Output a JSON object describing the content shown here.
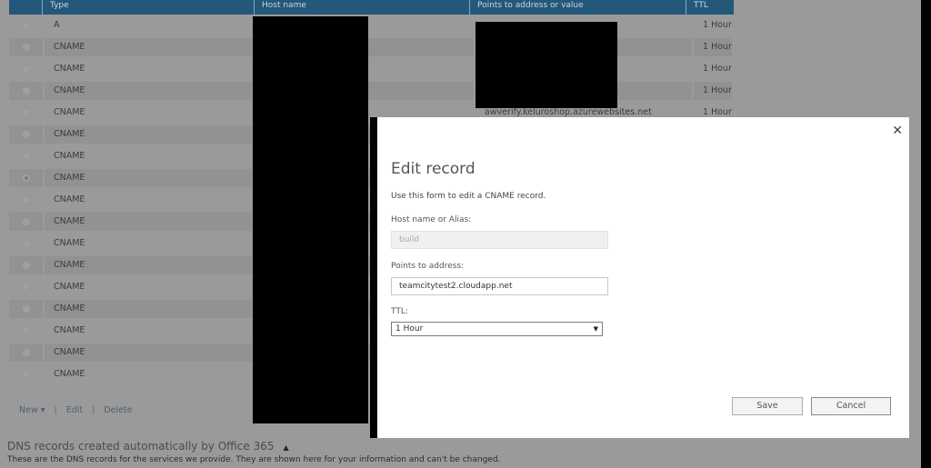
{
  "table": {
    "columns": [
      "",
      "Type",
      "Host name",
      "Points to address or value",
      "TTL"
    ],
    "rows": [
      {
        "type": "A",
        "host": "",
        "value": "",
        "ttl": "1 Hour",
        "selected": false
      },
      {
        "type": "CNAME",
        "host": "",
        "value": "",
        "ttl": "1 Hour",
        "selected": false
      },
      {
        "type": "CNAME",
        "host": "",
        "value": "",
        "ttl": "1 Hour",
        "selected": false
      },
      {
        "type": "CNAME",
        "host": "",
        "value": "",
        "ttl": "1 Hour",
        "selected": false
      },
      {
        "type": "CNAME",
        "host": "",
        "value": "awverify.keluroshop.azurewebsites.net",
        "ttl": "1 Hour",
        "selected": false
      },
      {
        "type": "CNAME",
        "host": "",
        "value": "",
        "ttl": "",
        "selected": false
      },
      {
        "type": "CNAME",
        "host": "",
        "value": "",
        "ttl": "",
        "selected": false
      },
      {
        "type": "CNAME",
        "host": "",
        "value": "",
        "ttl": "",
        "selected": true
      },
      {
        "type": "CNAME",
        "host": "",
        "value": "",
        "ttl": "",
        "selected": false
      },
      {
        "type": "CNAME",
        "host": "",
        "value": "",
        "ttl": "",
        "selected": false
      },
      {
        "type": "CNAME",
        "host": "",
        "value": "",
        "ttl": "",
        "selected": false
      },
      {
        "type": "CNAME",
        "host": "",
        "value": "",
        "ttl": "",
        "selected": false
      },
      {
        "type": "CNAME",
        "host": "",
        "value": "",
        "ttl": "",
        "selected": false
      },
      {
        "type": "CNAME",
        "host": "",
        "value": "",
        "ttl": "",
        "selected": false
      },
      {
        "type": "CNAME",
        "host": "",
        "value": "",
        "ttl": "",
        "selected": false
      },
      {
        "type": "CNAME",
        "host": "",
        "value": "",
        "ttl": "",
        "selected": false
      },
      {
        "type": "CNAME",
        "host": "",
        "value": "",
        "ttl": "",
        "selected": false
      }
    ]
  },
  "actions": {
    "new_label": "New ▾",
    "edit_label": "Edit",
    "delete_label": "Delete",
    "separator": "|"
  },
  "auto_section": {
    "title": "DNS records created automatically by Office 365",
    "caret": "▲",
    "description": "These are the DNS records for the services we provide. They are shown here for your information and can't be changed."
  },
  "dialog": {
    "close_glyph": "✕",
    "title": "Edit record",
    "instructions": "Use this form to edit a CNAME record.",
    "host_label": "Host name or Alias:",
    "host_value": "build",
    "points_label": "Points to address:",
    "points_value": "teamcitytest2.cloudapp.net",
    "ttl_label": "TTL:",
    "ttl_value": "1 Hour",
    "ttl_arrow": "▼",
    "save_label": "Save",
    "cancel_label": "Cancel"
  }
}
